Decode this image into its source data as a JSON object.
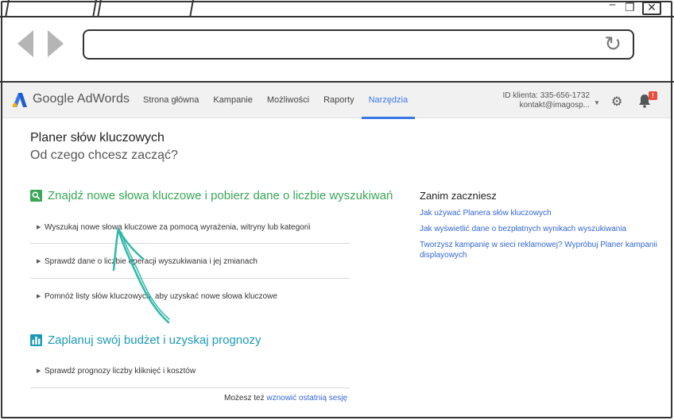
{
  "header": {
    "logo_text": "Google AdWords",
    "nav": [
      "Strona główna",
      "Kampanie",
      "Możliwości",
      "Raporty",
      "Narzędzia"
    ],
    "active_nav": "Narzędzia",
    "client_id": "ID klienta: 335-656-1732",
    "account_email": "kontakt@imagosp...",
    "notification_badge": "!"
  },
  "main": {
    "title": "Planer słów kluczowych",
    "subtitle": "Od czego chcesz zacząć?",
    "section1": {
      "heading": "Znajdź nowe słowa kluczowe i pobierz dane o liczbie wyszukiwań",
      "options": [
        "Wyszukaj nowe słowa kluczowe za pomocą wyrażenia, witryny lub kategorii",
        "Sprawdź dane o liczbie operacji wyszukiwania i jej zmianach",
        "Pomnóż listy słów kluczowych, aby uzyskać nowe słowa kluczowe"
      ]
    },
    "section2": {
      "heading": "Zaplanuj swój budżet i uzyskaj prognozy",
      "options": [
        "Sprawdź prognozy liczby kliknięć i kosztów"
      ]
    },
    "resume_prefix": "Możesz też",
    "resume_link": "wznowić ostatnią sesję"
  },
  "aside": {
    "title": "Zanim zaczniesz",
    "links": [
      "Jak używać Planera słów kluczowych",
      "Jak wyświetlić dane o bezpłatnych wynikach wyszukiwania",
      "Tworzysz kampanię w sieci reklamowej? Wypróbuj Planer kampanii displayowych"
    ]
  },
  "colors": {
    "accent_blue": "#3b78e7",
    "link_blue": "#3367d6",
    "green": "#3aa757",
    "teal": "#1a9bb5",
    "arrow_annotation": "#2fb9a8"
  }
}
